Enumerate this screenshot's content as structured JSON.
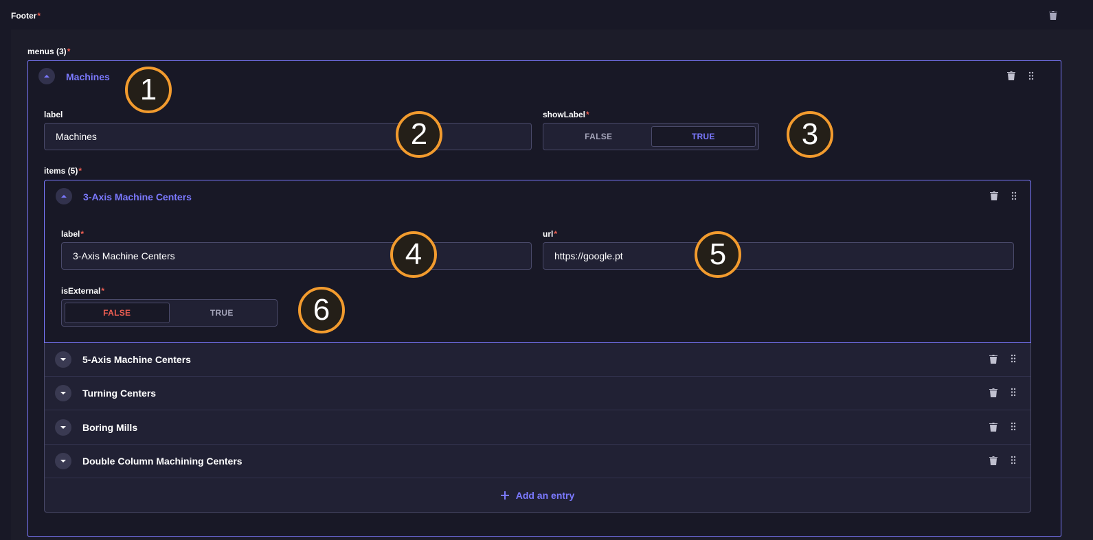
{
  "footer": {
    "title": "Footer",
    "required_mark": "*"
  },
  "menus": {
    "label": "menus (3)",
    "required_mark": "*",
    "open_menu": {
      "title": "Machines",
      "label_field": {
        "label": "label",
        "value": "Machines"
      },
      "show_label": {
        "label": "showLabel",
        "required_mark": "*",
        "options": [
          "FALSE",
          "TRUE"
        ],
        "selected": "TRUE"
      },
      "items": {
        "label": "items (5)",
        "required_mark": "*",
        "open_item": {
          "title": "3-Axis Machine Centers",
          "label_field": {
            "label": "label",
            "required_mark": "*",
            "value": "3-Axis Machine Centers"
          },
          "url_field": {
            "label": "url",
            "required_mark": "*",
            "value": "https://google.pt"
          },
          "is_external": {
            "label": "isExternal",
            "required_mark": "*",
            "options": [
              "FALSE",
              "TRUE"
            ],
            "selected": "FALSE"
          }
        },
        "collapsed": [
          {
            "title": "5-Axis Machine Centers"
          },
          {
            "title": "Turning Centers"
          },
          {
            "title": "Boring Mills"
          },
          {
            "title": "Double Column Machining Centers"
          }
        ],
        "add_entry_label": "Add an entry"
      }
    }
  },
  "annotations": [
    "1",
    "2",
    "3",
    "4",
    "5",
    "6"
  ],
  "colors": {
    "accent": "#7b79ff",
    "danger": "#ee5e52",
    "annotation": "#f29b2e",
    "background": "#181826"
  },
  "icons": [
    "trash-icon",
    "drag-handle-icon",
    "chevron-up-icon",
    "chevron-down-icon",
    "plus-icon"
  ]
}
